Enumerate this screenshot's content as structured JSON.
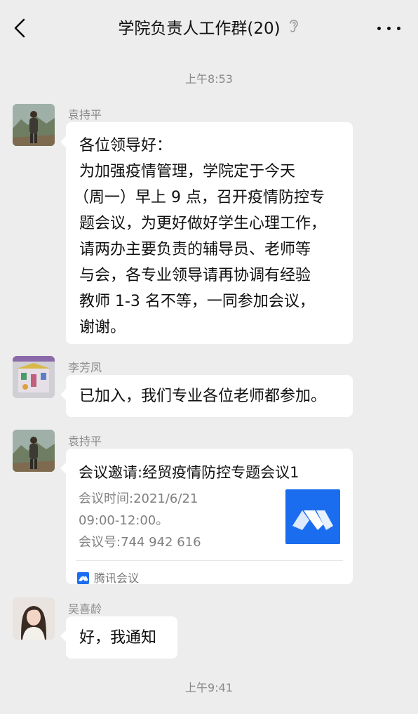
{
  "header": {
    "title": "学院负责人工作群(20)",
    "icons": {
      "back": "chevron-left-icon",
      "mute": "ear-icon",
      "more": "more-dots-icon"
    }
  },
  "timestamps": {
    "first": "上午8:53",
    "second": "上午9:41"
  },
  "messages": [
    {
      "sender": "袁持平",
      "lines": [
        "各位领导好：",
        "为加强疫情管理，学院定于今天",
        "（周一）早上 9 点，召开疫情防控专",
        "题会议，为更好做好学生心理工作，",
        "请两办主要负责的辅导员、老师等",
        "与会，各专业领导请再协调有经验",
        "教师 1-3 名不等，一同参加会议，",
        "谢谢。"
      ]
    },
    {
      "sender": "李芳凤",
      "text": "已加入，我们专业各位老师都参加。"
    },
    {
      "sender": "袁持平",
      "card": {
        "title": "会议邀请:经贸疫情防控专题会议1",
        "time_line1": "会议时间:2021/6/21",
        "time_line2": "09:00-12:00。",
        "meeting_no": "会议号:744 942 616",
        "source": "腾讯会议",
        "logo_icon": "tencent-meeting-logo-icon"
      }
    },
    {
      "sender": "吴喜龄",
      "text": "好，我通知"
    }
  ],
  "colors": {
    "background": "#ededed",
    "bubble": "#ffffff",
    "meeting_blue": "#1b6df0"
  }
}
